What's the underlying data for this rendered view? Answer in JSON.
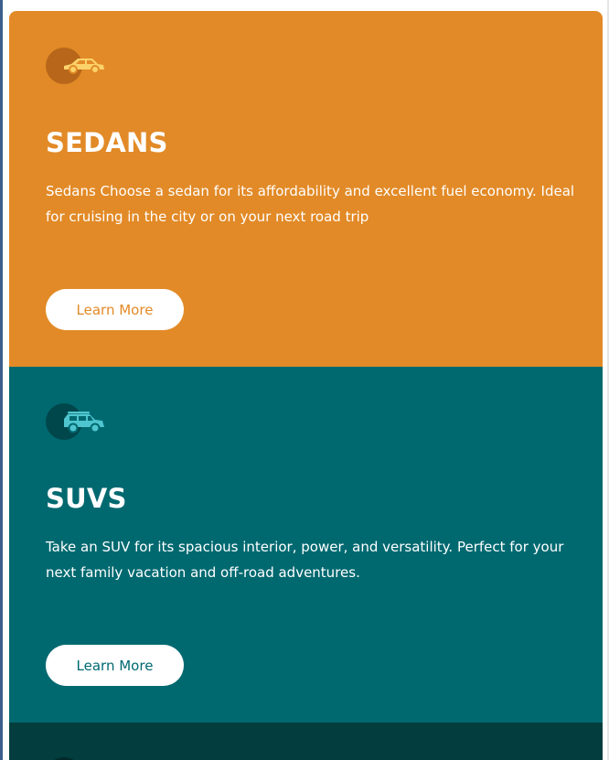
{
  "colors": {
    "sedans_bg": "#e28a27",
    "suvs_bg": "#006970",
    "luxury_bg": "#033d3d",
    "button_bg": "#ffffff"
  },
  "cards": [
    {
      "icon": "sedan-car-icon",
      "title": "SEDANS",
      "description": "Sedans Choose a sedan for its affordability and excellent fuel economy. Ideal for cruising in the city or on your next road trip",
      "button_label": "Learn More"
    },
    {
      "icon": "suv-car-icon",
      "title": "SUVS",
      "description": "Take an SUV for its spacious interior, power, and versatility. Perfect for your next family vacation and off-road adventures.",
      "button_label": "Learn More"
    },
    {
      "icon": "luxury-car-icon"
    }
  ]
}
